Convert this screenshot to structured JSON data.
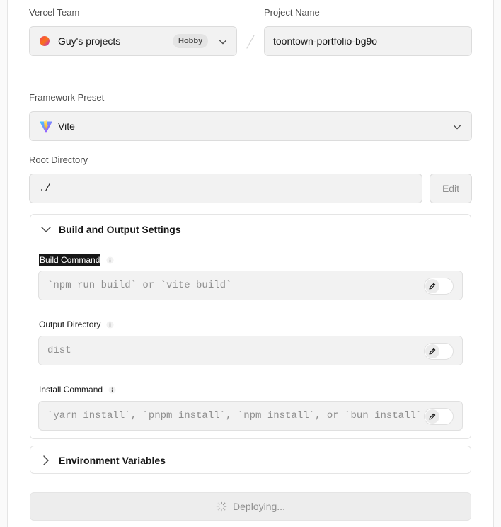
{
  "team": {
    "label": "Vercel Team",
    "name": "Guy's projects",
    "plan_badge": "Hobby"
  },
  "project": {
    "label": "Project Name",
    "value": "toontown-portfolio-bg9o"
  },
  "framework": {
    "label": "Framework Preset",
    "value": "Vite"
  },
  "root_directory": {
    "label": "Root Directory",
    "value": "./",
    "edit_label": "Edit"
  },
  "build_settings": {
    "title": "Build and Output Settings",
    "build_command": {
      "label": "Build Command",
      "placeholder": "`npm run build` or `vite build`",
      "override": false
    },
    "output_directory": {
      "label": "Output Directory",
      "placeholder": "dist",
      "override": false
    },
    "install_command": {
      "label": "Install Command",
      "placeholder": "`yarn install`, `pnpm install`, `npm install`, or `bun install`",
      "override": false
    }
  },
  "env_vars": {
    "title": "Environment Variables"
  },
  "deploy": {
    "label": "Deploying..."
  },
  "icons": {
    "team": "team-avatar-icon",
    "framework": "vite-logo-icon",
    "info": "info-icon",
    "edit": "pencil-icon",
    "expand": "chevron-down-icon",
    "collapse": "chevron-right-icon",
    "loading": "spinner-icon"
  },
  "colors": {
    "selection_bg": "#171717",
    "field_bg": "#f2f2f2",
    "muted_text": "#8f8f8f"
  }
}
